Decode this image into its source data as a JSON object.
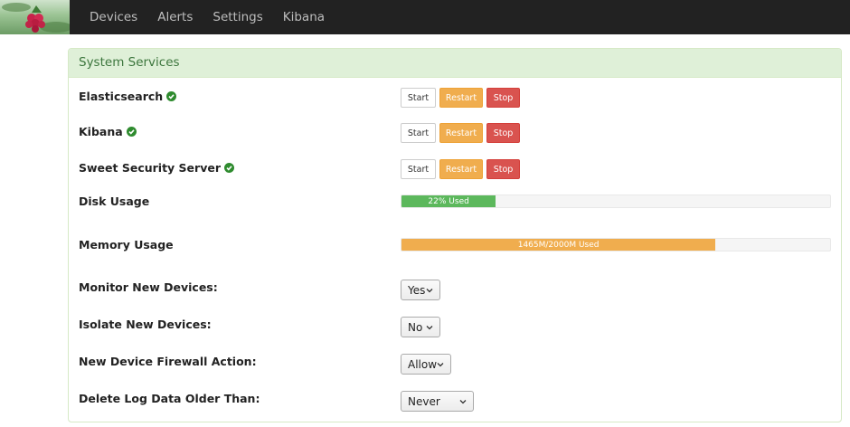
{
  "nav": {
    "items": [
      "Devices",
      "Alerts",
      "Settings",
      "Kibana"
    ]
  },
  "panel": {
    "title": "System Services"
  },
  "services": [
    {
      "name": "Elasticsearch",
      "status": "running"
    },
    {
      "name": "Kibana",
      "status": "running"
    },
    {
      "name": "Sweet Security Server",
      "status": "running"
    }
  ],
  "buttons": {
    "start": "Start",
    "restart": "Restart",
    "stop": "Stop"
  },
  "disk": {
    "label": "Disk Usage",
    "bar_text": "22% Used",
    "fraction": 0.22
  },
  "memory": {
    "label": "Memory Usage",
    "bar_text": "1465M/2000M Used",
    "fraction": 0.7325
  },
  "settings": {
    "monitor": {
      "label": "Monitor New Devices:",
      "value": "Yes"
    },
    "isolate": {
      "label": "Isolate New Devices:",
      "value": "No"
    },
    "firewall": {
      "label": "New Device Firewall Action:",
      "value": "Allow"
    },
    "delete_logs": {
      "label": "Delete Log Data Older Than:",
      "value": "Never"
    }
  },
  "colors": {
    "success": "#5cb85c",
    "warning": "#f0ad4e",
    "danger": "#d9534f",
    "status_ok": "#2e8b2e"
  }
}
